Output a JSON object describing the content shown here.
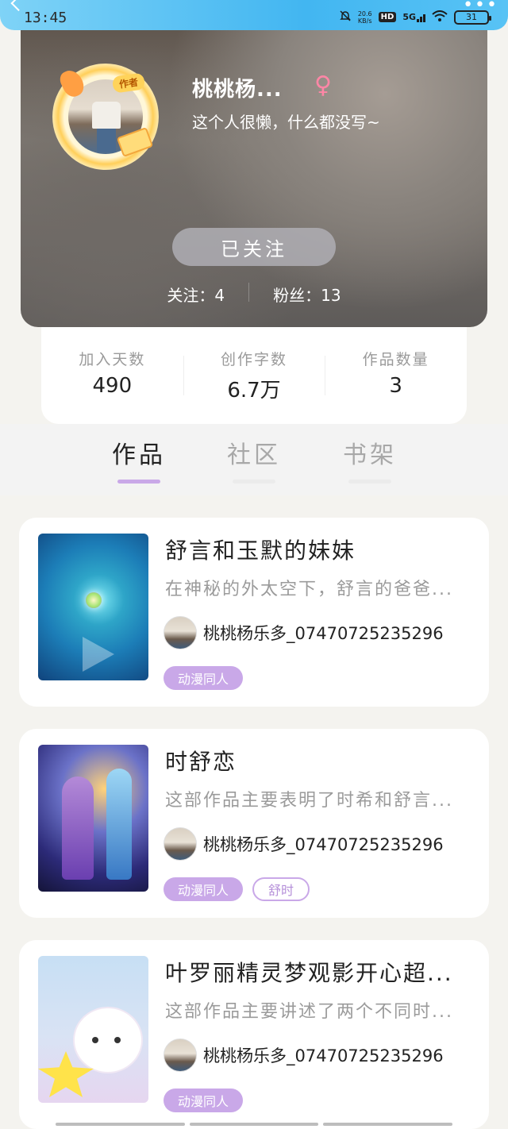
{
  "status_bar": {
    "time": "13:45",
    "net_speed_top": "20.6",
    "net_speed_bottom": "KB/s",
    "hd": "HD",
    "signal": "5G",
    "battery": "31"
  },
  "profile": {
    "name": "桃桃杨...",
    "gender_symbol": "♀",
    "bio": "这个人很懒，什么都没写~",
    "avatar_badge": "作者",
    "follow_button": "已关注",
    "following_label": "关注：4",
    "followers_label": "粉丝：13"
  },
  "info": [
    {
      "label": "加入天数",
      "value": "490"
    },
    {
      "label": "创作字数",
      "value": "6.7万"
    },
    {
      "label": "作品数量",
      "value": "3"
    }
  ],
  "tabs": [
    {
      "label": "作品",
      "active": true
    },
    {
      "label": "社区",
      "active": false
    },
    {
      "label": "书架",
      "active": false
    }
  ],
  "works": [
    {
      "title": "舒言和玉默的妹妹",
      "desc": "在神秘的外太空下，舒言的爸爸...",
      "author": "桃桃杨乐多_07470725235296",
      "tags": [
        {
          "text": "动漫同人",
          "style": "fill"
        }
      ]
    },
    {
      "title": "时舒恋",
      "desc": "这部作品主要表明了时希和舒言...",
      "author": "桃桃杨乐多_07470725235296",
      "tags": [
        {
          "text": "动漫同人",
          "style": "fill"
        },
        {
          "text": "舒时",
          "style": "outline"
        }
      ]
    },
    {
      "title": "叶罗丽精灵梦观影开心超...",
      "desc": "这部作品主要讲述了两个不同时...",
      "author": "桃桃杨乐多_07470725235296",
      "tags": [
        {
          "text": "动漫同人",
          "style": "fill"
        }
      ]
    }
  ],
  "colors": {
    "accent_purple": "#c9a8e8",
    "status_bar_blue": "#42b6f1",
    "gender_pink": "#ff86a6"
  }
}
